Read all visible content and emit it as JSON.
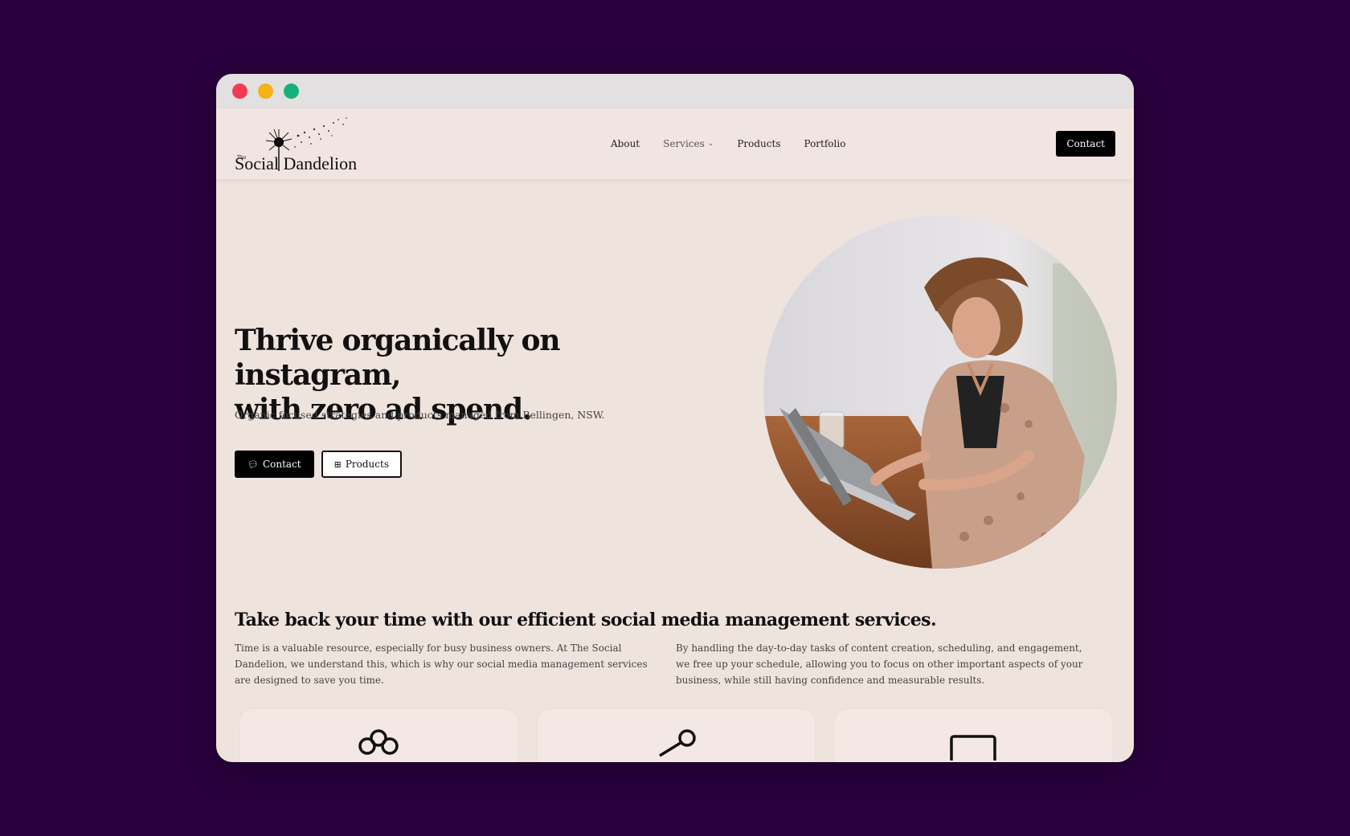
{
  "window": {
    "controls": [
      "close",
      "minimize",
      "maximize"
    ],
    "colors": {
      "close": "#ee3c52",
      "minimize": "#f4b316",
      "maximize": "#17b07a"
    }
  },
  "nav": {
    "logo_small": "The",
    "logo_text": "Social Dandelion",
    "links": [
      "About",
      "Services",
      "Products",
      "Portfolio"
    ],
    "services_icon": "chevron-down-icon",
    "cta": "Contact"
  },
  "hero": {
    "title_line1": "Thrive organically on instagram,",
    "title_line2": "with zero ad spend.",
    "subtitle": "Organic focused strategies and products managed from Bellingen, NSW.",
    "primary_button": "Contact",
    "primary_icon": "chat-bubble-icon",
    "secondary_button": "Products",
    "secondary_icon": "grid-icon",
    "photo": "woman-typing-on-laptop-photo"
  },
  "services_intro": {
    "title": "Take back your time with our efficient social media management services.",
    "col1": "Time is a valuable resource, especially for busy business owners. At The Social Dandelion, we understand this, which is why our social media management services are designed to save you time.",
    "col2": "By handling the day-to-day tasks of content creation, scheduling, and engagement, we free up your schedule, allowing you to focus on other important aspects of your business, while still having confidence and measurable results."
  },
  "cards": [
    {
      "icon": "flower-icon"
    },
    {
      "icon": "share-icon"
    },
    {
      "icon": "monitor-icon"
    }
  ]
}
